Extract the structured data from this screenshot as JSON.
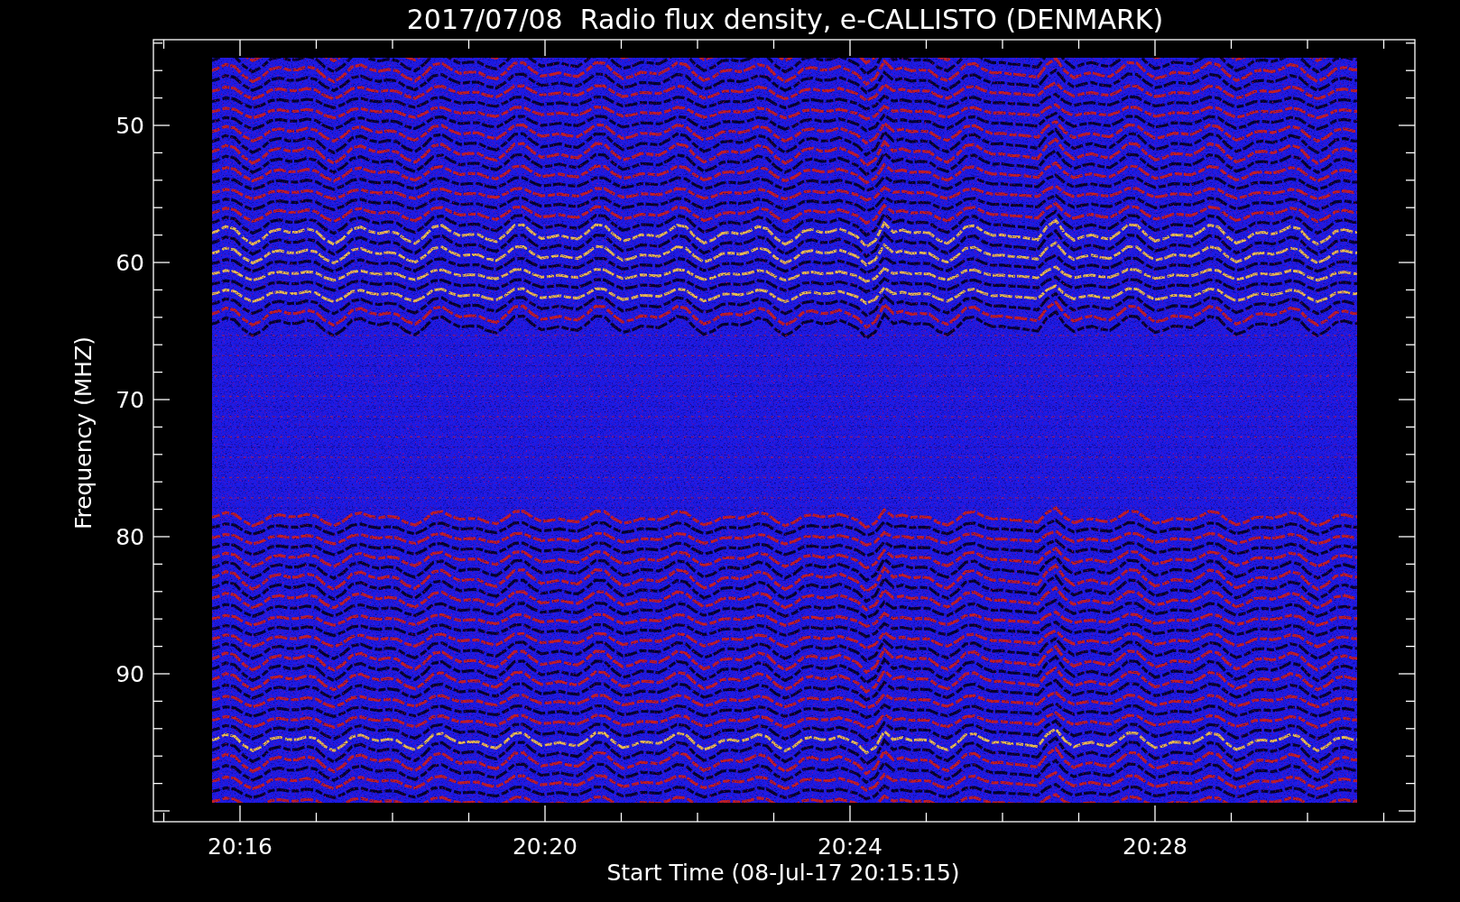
{
  "plot": {
    "title": "2017/07/08  Radio flux density, e-CALLISTO (DENMARK)",
    "xlabel": "Start Time (08-Jul-17 20:15:15)",
    "ylabel": "Frequency (MHZ)",
    "x_ticks": [
      "20:16",
      "20:20",
      "20:24",
      "20:28"
    ],
    "y_ticks": [
      "50",
      "60",
      "70",
      "80",
      "90"
    ]
  }
}
